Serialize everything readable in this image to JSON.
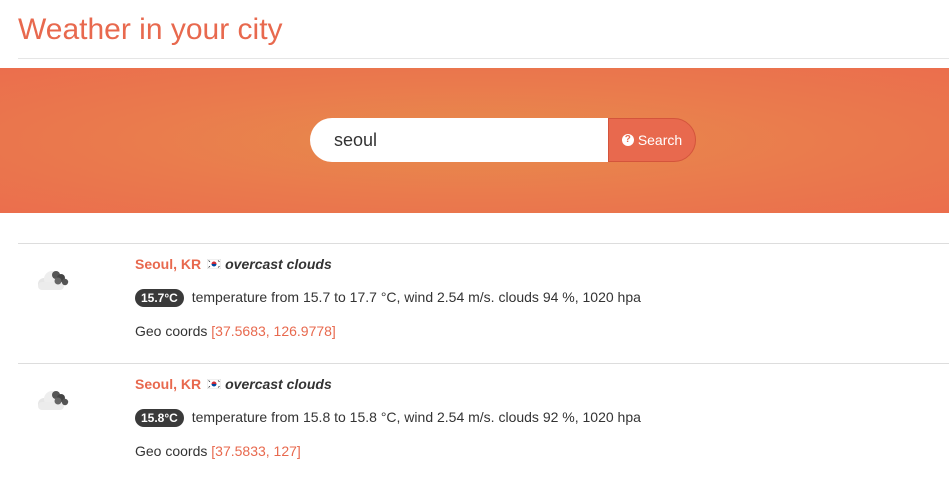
{
  "page": {
    "title": "Weather in your city"
  },
  "search": {
    "value": "seoul",
    "placeholder": "",
    "button_label": "Search",
    "button_icon": "question-circle-icon"
  },
  "colors": {
    "accent": "#e8694e",
    "hero_center": "#e78c4c",
    "hero_edge": "#eb6e4d",
    "badge": "#3a3a3a"
  },
  "results": [
    {
      "city": "Seoul, KR",
      "flag": "south-korea-flag-icon",
      "description": "overcast clouds",
      "badge": "15.7°C",
      "details": "temperature from 15.7 to 17.7 °C, wind 2.54 m/s. clouds 94 %, 1020 hpa",
      "geo_label": "Geo coords",
      "geo_coords": "[37.5683, 126.9778]",
      "icon": "cloud-icon"
    },
    {
      "city": "Seoul, KR",
      "flag": "south-korea-flag-icon",
      "description": "overcast clouds",
      "badge": "15.8°C",
      "details": "temperature from 15.8 to 15.8 °C, wind 2.54 m/s. clouds 92 %, 1020 hpa",
      "geo_label": "Geo coords",
      "geo_coords": "[37.5833, 127]",
      "icon": "cloud-icon"
    }
  ]
}
